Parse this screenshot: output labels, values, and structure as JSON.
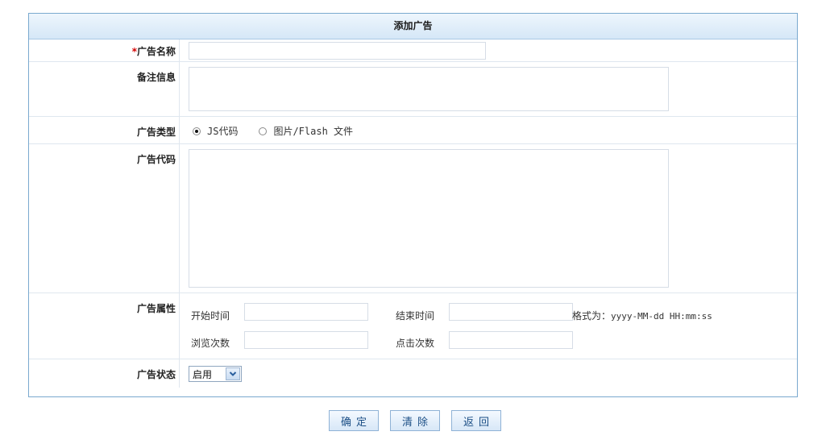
{
  "form": {
    "title": "添加广告",
    "name": {
      "required_mark": "*",
      "label": "广告名称",
      "value": ""
    },
    "remark": {
      "label": "备注信息",
      "value": ""
    },
    "type": {
      "label": "广告类型",
      "options": [
        {
          "label": "JS代码",
          "selected": true
        },
        {
          "label": "图片/Flash 文件",
          "selected": false
        }
      ]
    },
    "code": {
      "label": "广告代码",
      "value": ""
    },
    "attrs": {
      "label": "广告属性",
      "start_label": "开始时间",
      "start_value": "",
      "end_label": "结束时间",
      "end_value": "",
      "format_prefix": "格式为：",
      "format_value": "yyyy-MM-dd HH:mm:ss",
      "views_label": "浏览次数",
      "views_value": "",
      "clicks_label": "点击次数",
      "clicks_value": ""
    },
    "status": {
      "label": "广告状态",
      "selected": "启用"
    }
  },
  "actions": {
    "confirm": "确定",
    "clear": "清除",
    "back": "返回"
  }
}
